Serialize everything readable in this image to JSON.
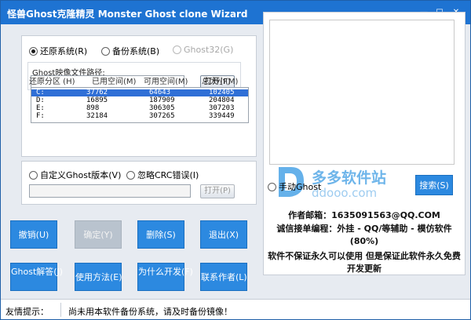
{
  "window": {
    "title": "怪兽Ghost克隆精灵 Monster Ghost clone Wizard",
    "minimize_glyph": "—",
    "maximize_glyph": "□",
    "close_glyph": "✕"
  },
  "mode": {
    "restore_label": "还原系统(R)",
    "backup_label": "备份系统(B)",
    "ghost32_label": "Ghost32(G)",
    "selected": "restore"
  },
  "image_path": {
    "label": "Ghost映像文件路径:",
    "value": "",
    "open_button": "打开(F)"
  },
  "partitions": {
    "headers": [
      "还原分区 (H)",
      "已用空间(M)",
      "可用空间(M)",
      "总大小(M)"
    ],
    "rows": [
      {
        "drive": "C:",
        "used": "37762",
        "free": "64643",
        "total": "102405",
        "selected": true
      },
      {
        "drive": "D:",
        "used": "16895",
        "free": "187909",
        "total": "204804",
        "selected": false
      },
      {
        "drive": "E:",
        "used": "898",
        "free": "306305",
        "total": "307203",
        "selected": false
      },
      {
        "drive": "F:",
        "used": "32184",
        "free": "307265",
        "total": "339449",
        "selected": false
      }
    ]
  },
  "options": {
    "custom_ghost_label": "自定义Ghost版本(V)",
    "ignore_crc_label": "忽略CRC错误(I)",
    "custom_path_value": "",
    "open_button": "打开(P)"
  },
  "manual_ghost": {
    "label": "手动Ghost",
    "search_button": "搜索(S)"
  },
  "watermark": {
    "text": "多多软件站",
    "url": "ddooo.com",
    "colors": {
      "main": "#4aa3e6",
      "sub": "#8ec4ee"
    }
  },
  "info": {
    "email": "作者邮箱：1635091563@QQ.COM",
    "service": "诚信接单编程：外挂 - QQ/等辅助 - 模仿软件(80%)",
    "note": "软件不保证永久可以使用 但是保证此软件永久免费开发更新"
  },
  "buttons": {
    "undo": "撤销(U)",
    "confirm": "确定(Y)",
    "delete": "删除(S)",
    "exit": "退出(X)",
    "ghost_answer": "Ghost解答(J)",
    "usage": "使用方法(E)",
    "why": "为什么开发(F)",
    "contact": "联系作者(L)"
  },
  "status": {
    "label": "友情提示：",
    "message": "尚未用本软件备份系统，请及时备份镜像！"
  },
  "colors": {
    "titlebar": "#1e73d2",
    "button": "#2c89e0",
    "selection": "#2f6fd6"
  }
}
